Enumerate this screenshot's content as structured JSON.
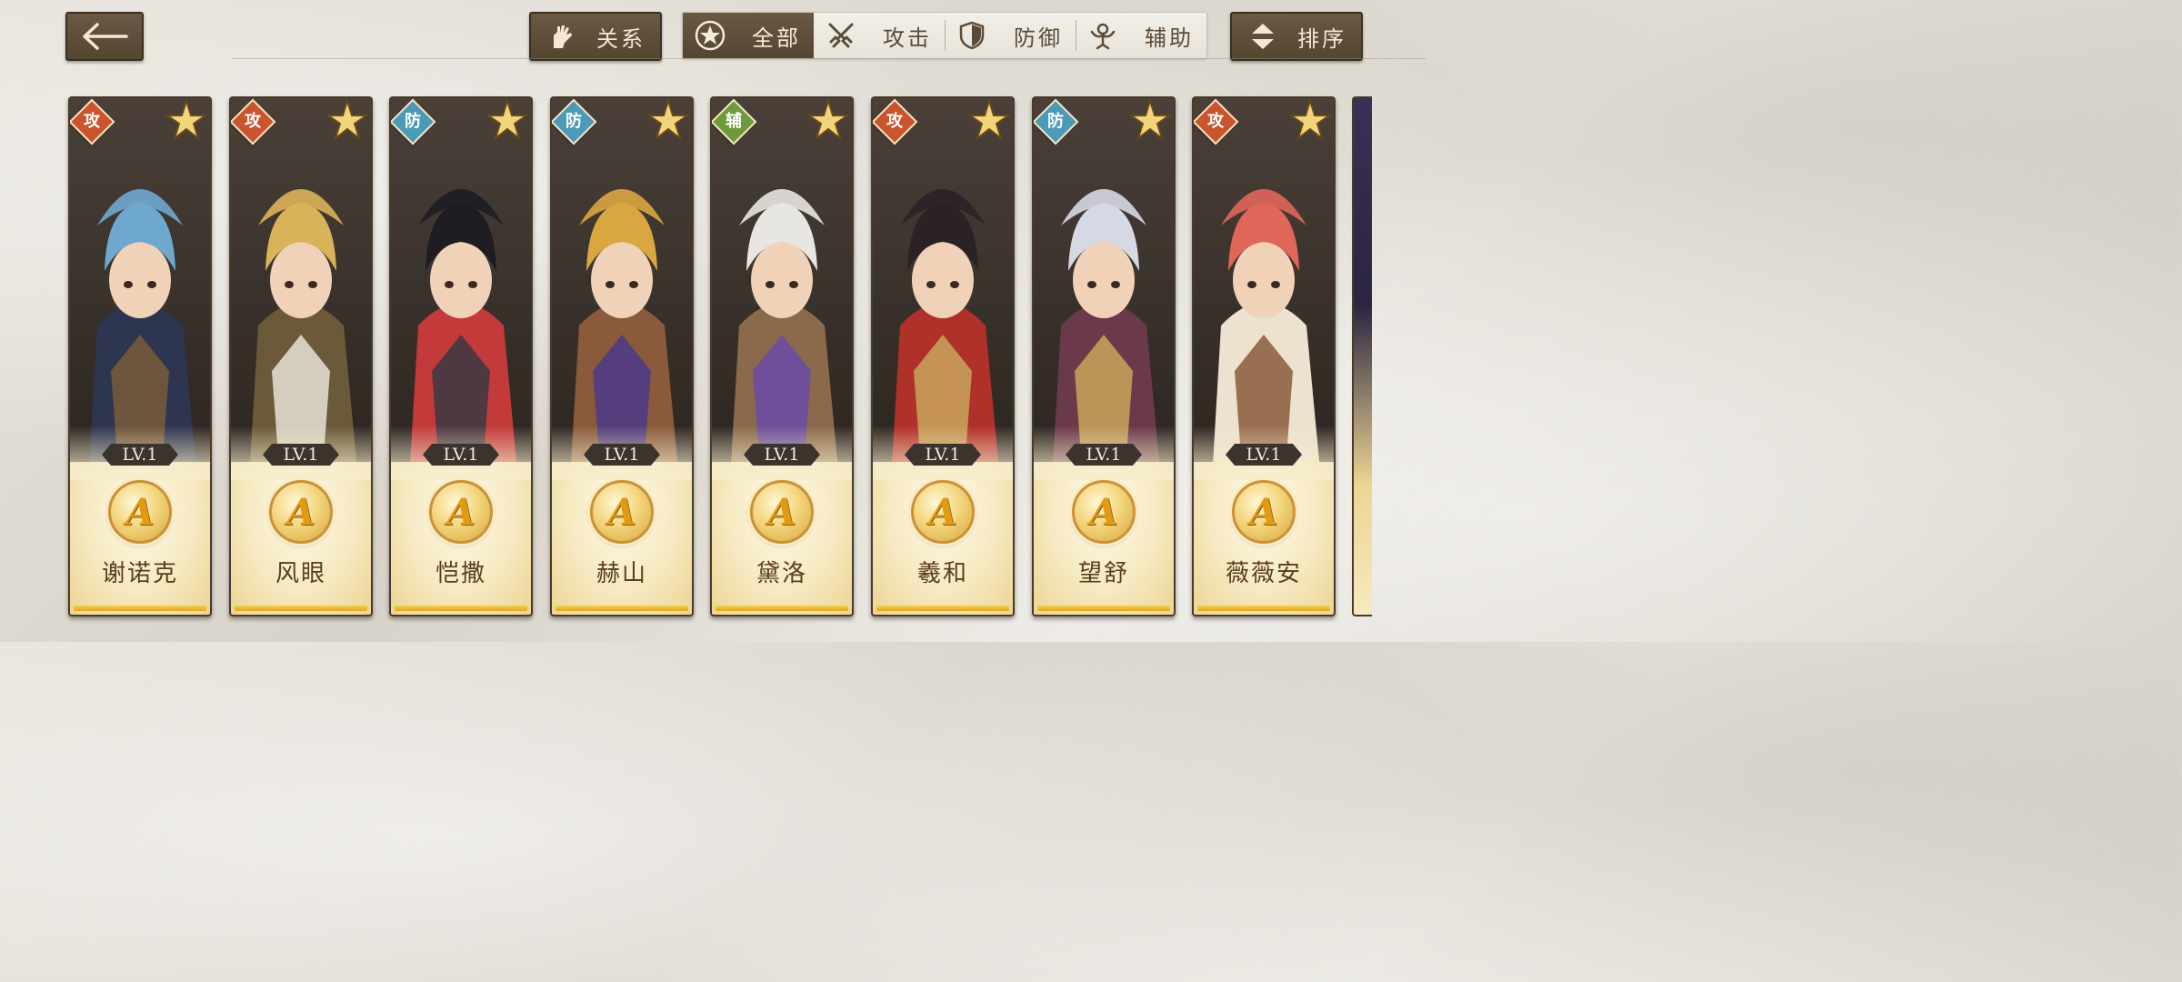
{
  "nav": {
    "back_icon": "arrow-left-icon"
  },
  "relation": {
    "label": "关系",
    "icon": "glove-hand-icon"
  },
  "filters": [
    {
      "label": "全部",
      "icon": "star-circle-icon",
      "active": true
    },
    {
      "label": "攻击",
      "icon": "crossed-swords-icon",
      "active": false
    },
    {
      "label": "防御",
      "icon": "shield-icon",
      "active": false
    },
    {
      "label": "辅助",
      "icon": "support-figure-icon",
      "active": false
    }
  ],
  "sort": {
    "label": "排序",
    "icon": "up-down-arrows-icon"
  },
  "colors": {
    "attack": "#c9542d",
    "defense": "#4a9ab8",
    "support": "#6c9a3c",
    "button_dark": "#5f4f3a",
    "gold": "#e29a12"
  },
  "heroes": [
    {
      "name": "谢诺克",
      "role": "攻",
      "role_type": "attack",
      "level": "LV.1",
      "rank": "A",
      "art": [
        "#6fa8cf",
        "#2d3550",
        "#7a5a3a"
      ]
    },
    {
      "name": "风眼",
      "role": "攻",
      "role_type": "attack",
      "level": "LV.1",
      "rank": "A",
      "art": [
        "#d9b35a",
        "#6b5a3a",
        "#e8e2d6"
      ]
    },
    {
      "name": "恺撒",
      "role": "防",
      "role_type": "defense",
      "level": "LV.1",
      "rank": "A",
      "art": [
        "#1d1d22",
        "#c23a3a",
        "#3a3a45"
      ]
    },
    {
      "name": "赫山",
      "role": "防",
      "role_type": "defense",
      "level": "LV.1",
      "rank": "A",
      "art": [
        "#d9a640",
        "#8a5a3a",
        "#4a3a8a"
      ]
    },
    {
      "name": "黛洛",
      "role": "辅",
      "role_type": "support",
      "level": "LV.1",
      "rank": "A",
      "art": [
        "#e8e6e0",
        "#8a6a4a",
        "#6a4aa8"
      ]
    },
    {
      "name": "羲和",
      "role": "攻",
      "role_type": "attack",
      "level": "LV.1",
      "rank": "A",
      "art": [
        "#2a2225",
        "#b0302a",
        "#c9a45a"
      ]
    },
    {
      "name": "望舒",
      "role": "防",
      "role_type": "defense",
      "level": "LV.1",
      "rank": "A",
      "art": [
        "#d6d8e4",
        "#6a3a4a",
        "#c9a45a"
      ]
    },
    {
      "name": "薇薇安",
      "role": "攻",
      "role_type": "attack",
      "level": "LV.1",
      "rank": "A",
      "art": [
        "#e0665a",
        "#ece2cf",
        "#8a5a3a"
      ]
    }
  ]
}
